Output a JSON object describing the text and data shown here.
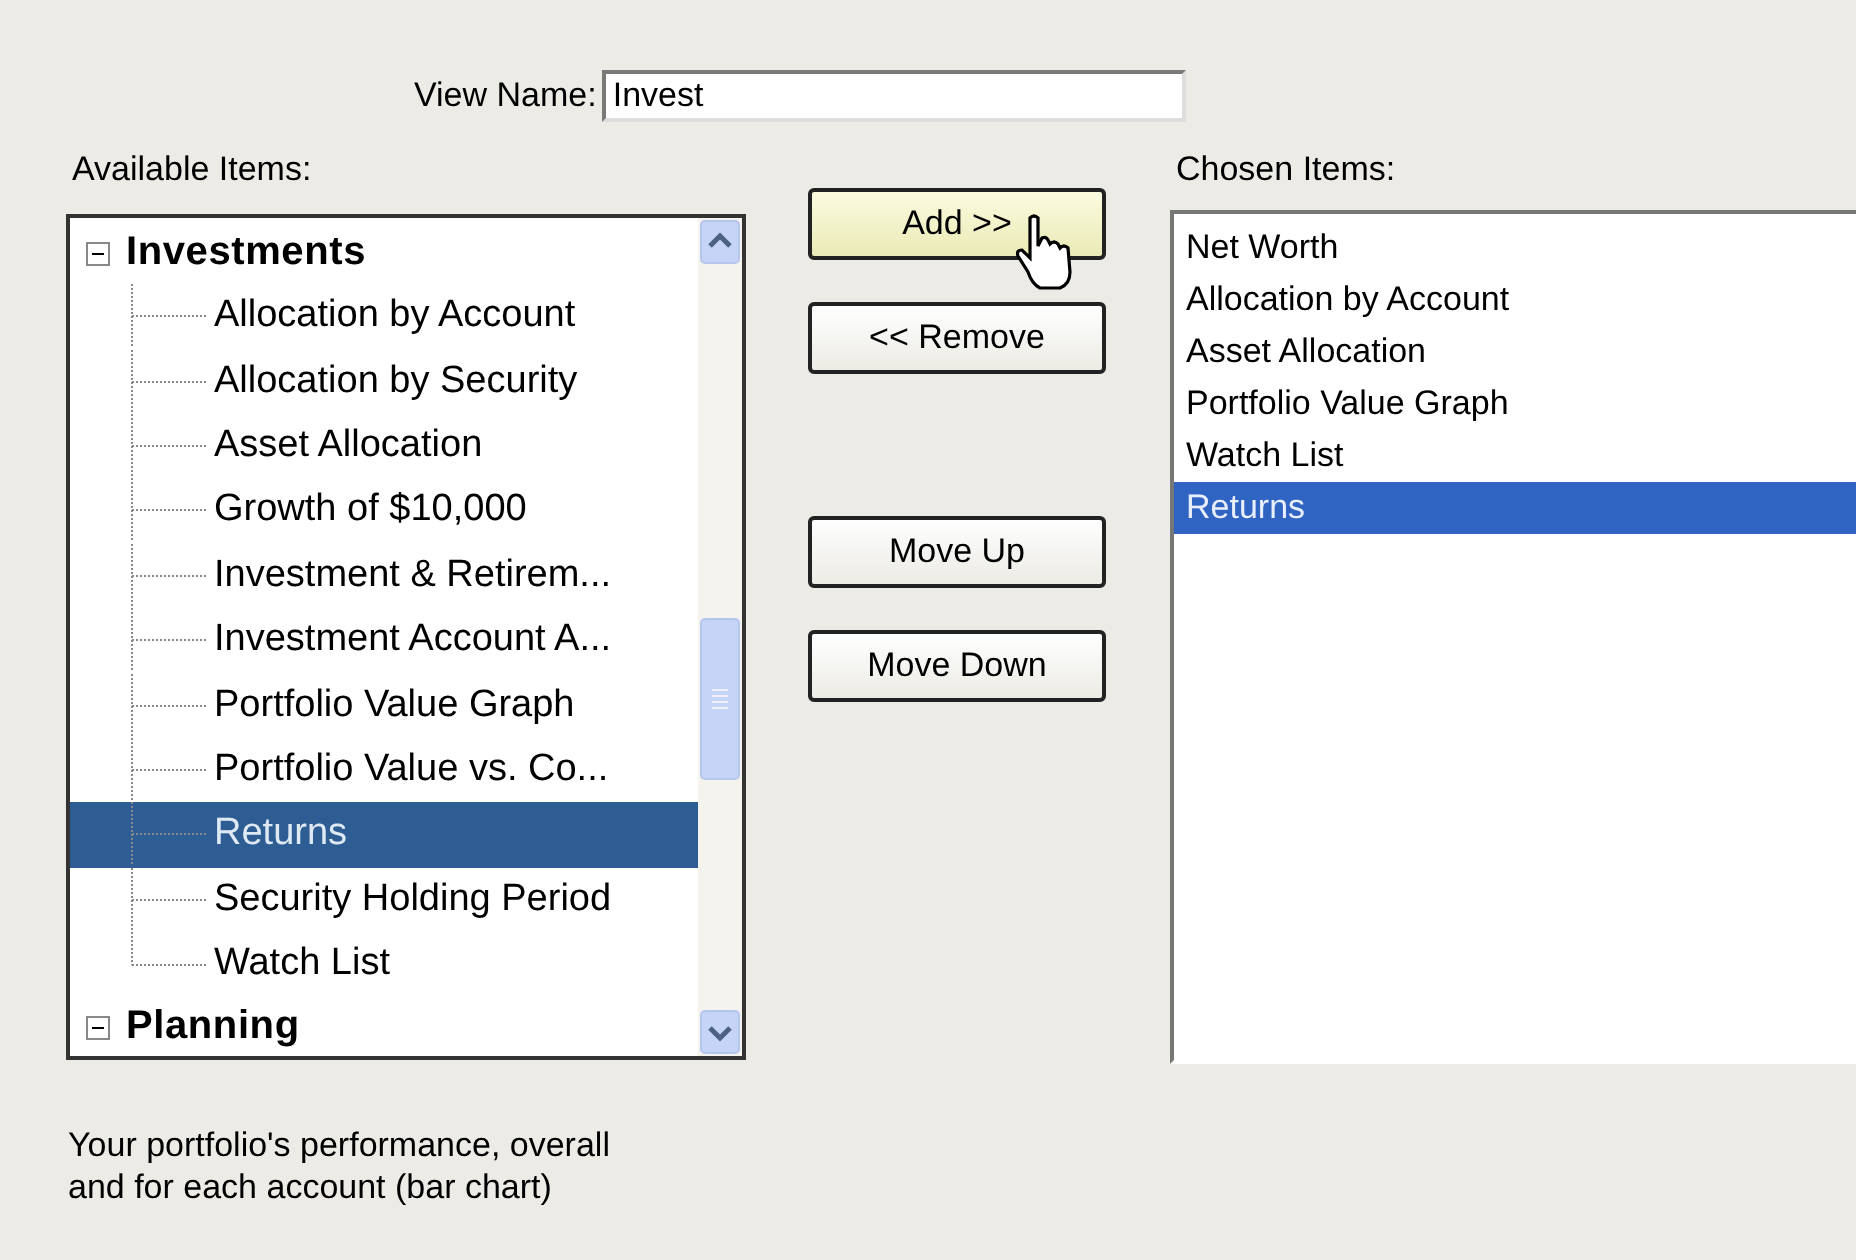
{
  "view_name": {
    "label": "View Name:",
    "value": "Invest"
  },
  "available": {
    "label": "Available Items:",
    "tree": [
      {
        "label": "Investments",
        "expanded": true,
        "children": [
          {
            "label": "Allocation by Account",
            "selected": false
          },
          {
            "label": "Allocation by Security",
            "selected": false
          },
          {
            "label": "Asset Allocation",
            "selected": false
          },
          {
            "label": "Growth of $10,000",
            "selected": false
          },
          {
            "label": "Investment & Retirem...",
            "selected": false
          },
          {
            "label": "Investment Account A...",
            "selected": false
          },
          {
            "label": "Portfolio Value Graph",
            "selected": false
          },
          {
            "label": "Portfolio Value vs. Co...",
            "selected": false
          },
          {
            "label": "Returns",
            "selected": true
          },
          {
            "label": "Security Holding Period",
            "selected": false
          },
          {
            "label": "Watch List",
            "selected": false
          }
        ]
      },
      {
        "label": "Planning",
        "expanded": true
      }
    ]
  },
  "buttons": [
    {
      "label": "Add >>",
      "hovered": true
    },
    {
      "label": "<< Remove",
      "hovered": false
    },
    {
      "label": "Move Up",
      "hovered": false
    },
    {
      "label": "Move Down",
      "hovered": false
    }
  ],
  "chosen": {
    "label": "Chosen Items:",
    "items": [
      {
        "label": "Net Worth",
        "selected": false
      },
      {
        "label": "Allocation by Account",
        "selected": false
      },
      {
        "label": "Asset Allocation",
        "selected": false
      },
      {
        "label": "Portfolio Value Graph",
        "selected": false
      },
      {
        "label": "Watch List",
        "selected": false
      },
      {
        "label": "Returns",
        "selected": true
      }
    ]
  },
  "description": "Your portfolio's performance, overall and for each account (bar chart)"
}
